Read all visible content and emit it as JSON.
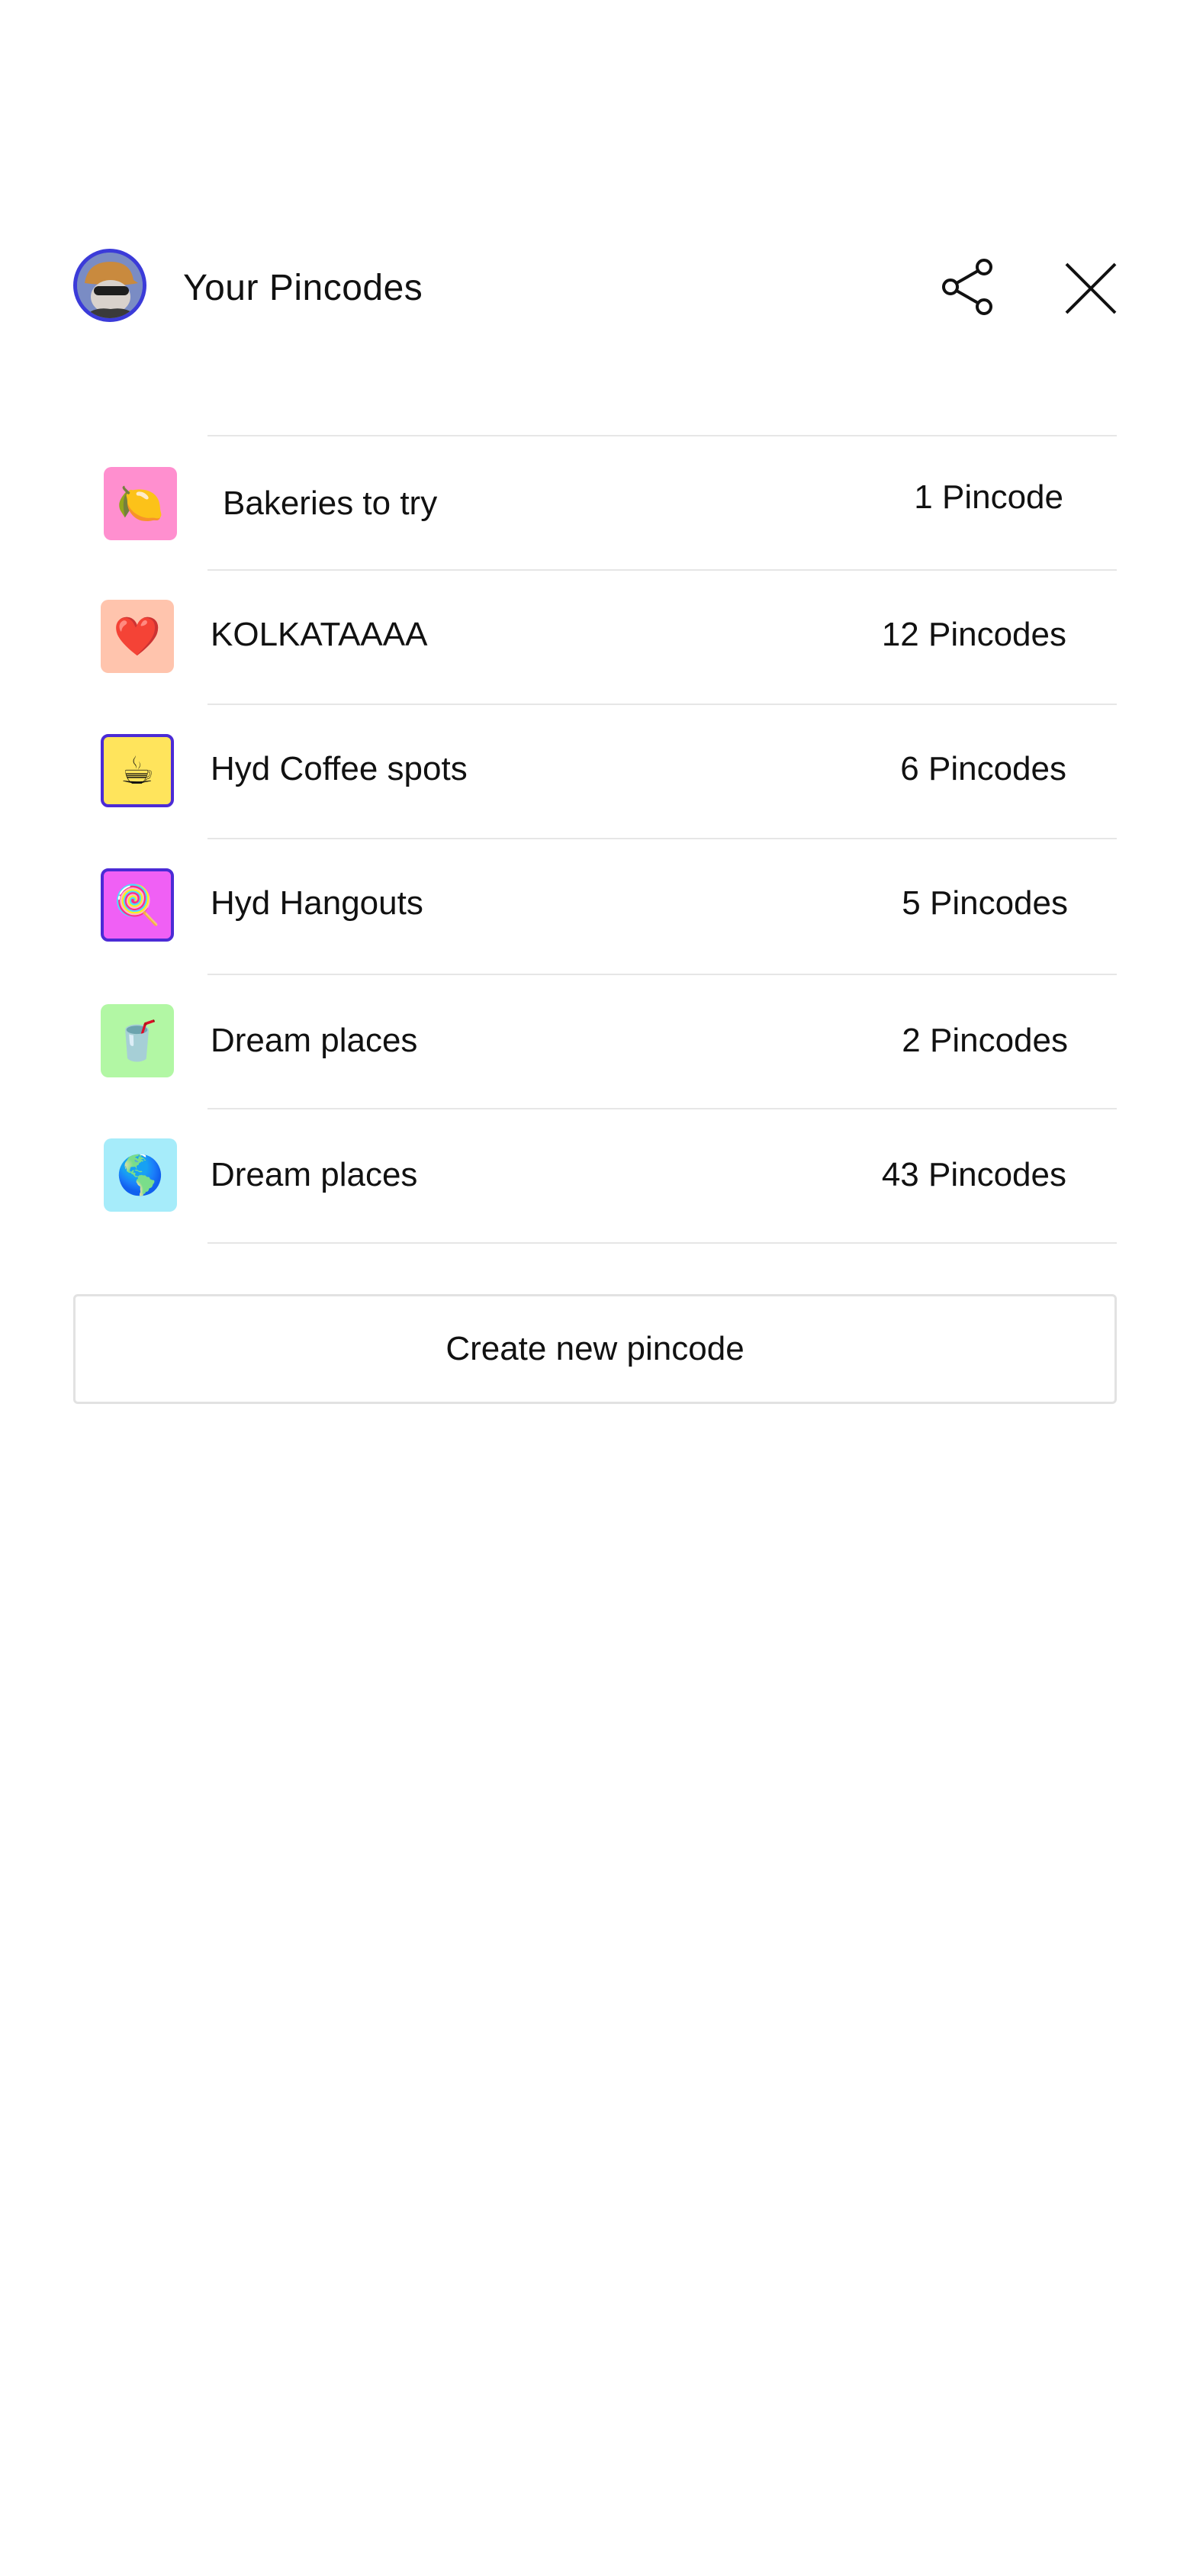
{
  "header": {
    "title": "Your Pincodes",
    "avatar_icon": "user-avatar",
    "share_icon": "share-icon",
    "close_icon": "close-icon"
  },
  "lists": [
    {
      "emoji": "🍋",
      "icon_name": "lemon-icon",
      "icon_bg": "#ff8fcf",
      "bordered": false,
      "name": "Bakeries to try",
      "count": "1 Pincode"
    },
    {
      "emoji": "❤️",
      "icon_name": "heart-icon",
      "icon_bg": "#ffc4ad",
      "bordered": false,
      "name": "KOLKATAAAA",
      "count": "12 Pincodes"
    },
    {
      "emoji": "☕",
      "icon_name": "coffee-icon",
      "icon_bg": "#ffe45c",
      "bordered": true,
      "name": "Hyd Coffee spots",
      "count": "6 Pincodes"
    },
    {
      "emoji": "🍭",
      "icon_name": "lollipop-icon",
      "icon_bg": "#f060f5",
      "bordered": true,
      "name": "Hyd Hangouts",
      "count": "5 Pincodes"
    },
    {
      "emoji": "🥤",
      "icon_name": "cup-with-straw-icon",
      "icon_bg": "#b2f7a4",
      "bordered": false,
      "name": "Dream places",
      "count": "2 Pincodes"
    },
    {
      "emoji": "🌎",
      "icon_name": "globe-icon",
      "icon_bg": "#a6ecfa",
      "bordered": false,
      "name": "Dream places",
      "count": "43 Pincodes"
    }
  ],
  "create_button": {
    "label": "Create new pincode"
  },
  "colors": {
    "background": "#ffffff",
    "text": "#111111",
    "divider": "#e6e6e6",
    "avatar_border": "#3b3bd9",
    "icon_border": "#4b2bd6"
  }
}
